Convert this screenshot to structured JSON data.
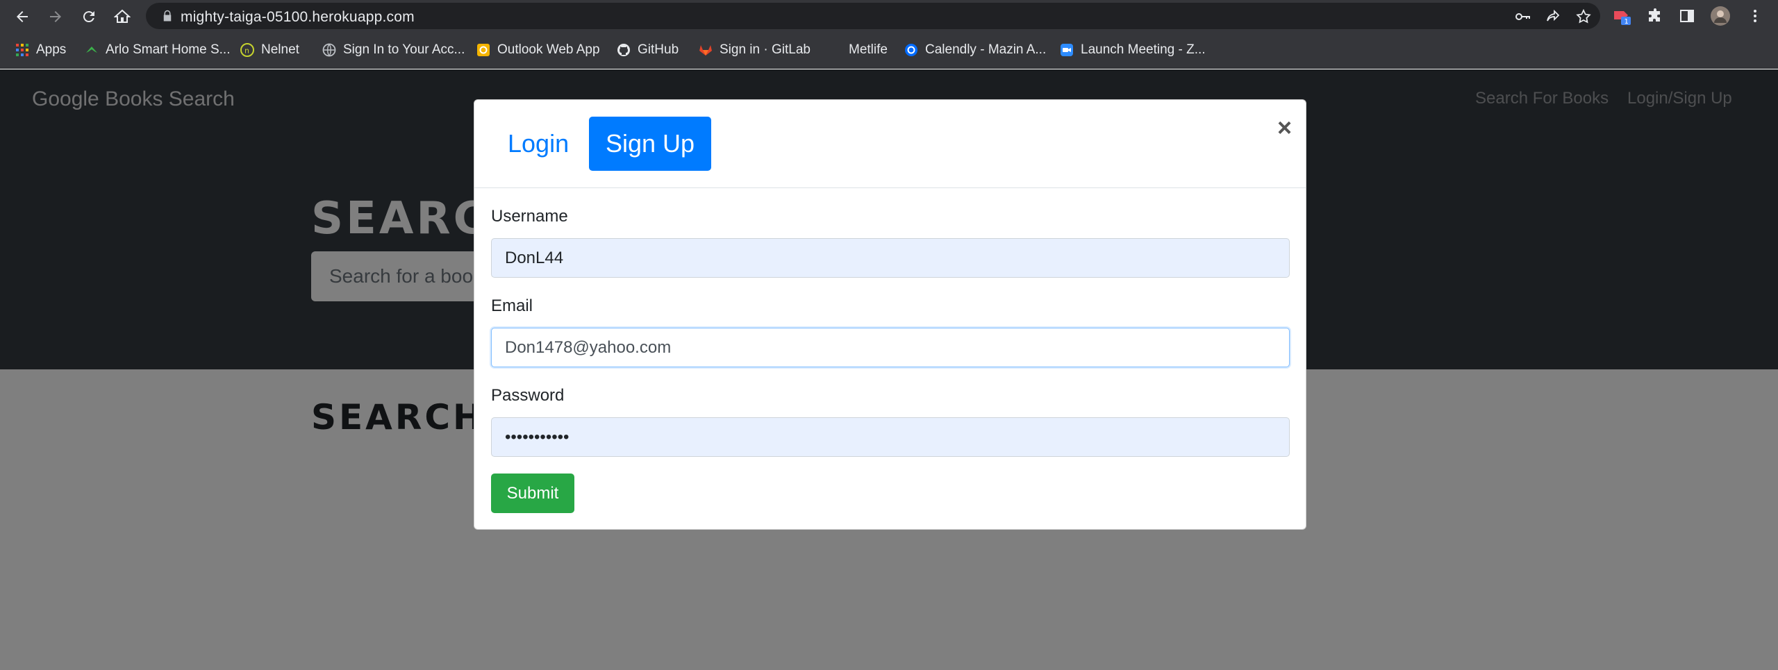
{
  "browser": {
    "url": "mighty-taiga-05100.herokuapp.com",
    "bookmarks": [
      {
        "label": "Apps",
        "icon": "apps-grid-icon"
      },
      {
        "label": "Arlo Smart Home S...",
        "icon": "arlo-icon"
      },
      {
        "label": "Nelnet",
        "icon": "nelnet-icon"
      },
      {
        "label": "Sign In to Your Acc...",
        "icon": "globe-icon"
      },
      {
        "label": "Outlook Web App",
        "icon": "outlook-icon"
      },
      {
        "label": "GitHub",
        "icon": "github-icon"
      },
      {
        "label": "Sign in · GitLab",
        "icon": "gitlab-icon"
      },
      {
        "label": "Metlife",
        "icon": "metlife-icon"
      },
      {
        "label": "Calendly - Mazin A...",
        "icon": "calendly-icon"
      },
      {
        "label": "Launch Meeting - Z...",
        "icon": "zoom-icon"
      }
    ],
    "extension_badge": "1"
  },
  "navbar": {
    "brand": "Google Books Search",
    "links": [
      "Search For Books",
      "Login/Sign Up"
    ]
  },
  "hero": {
    "title": "SEARCH FOR BOOKS!",
    "search_placeholder": "Search for a book"
  },
  "results": {
    "title": "SEARCH FOR A BOOK TO BEGIN"
  },
  "modal": {
    "tabs": [
      "Login",
      "Sign Up"
    ],
    "active_tab": "Sign Up",
    "close_label": "×",
    "fields": {
      "username": {
        "label": "Username",
        "value": "DonL44"
      },
      "email": {
        "label": "Email",
        "value": "Don1478@yahoo.com"
      },
      "password": {
        "label": "Password",
        "value": "•••••••••••"
      }
    },
    "submit_label": "Submit"
  },
  "colors": {
    "primary": "#007bff",
    "success": "#28a745",
    "navbar": "#343a40"
  }
}
